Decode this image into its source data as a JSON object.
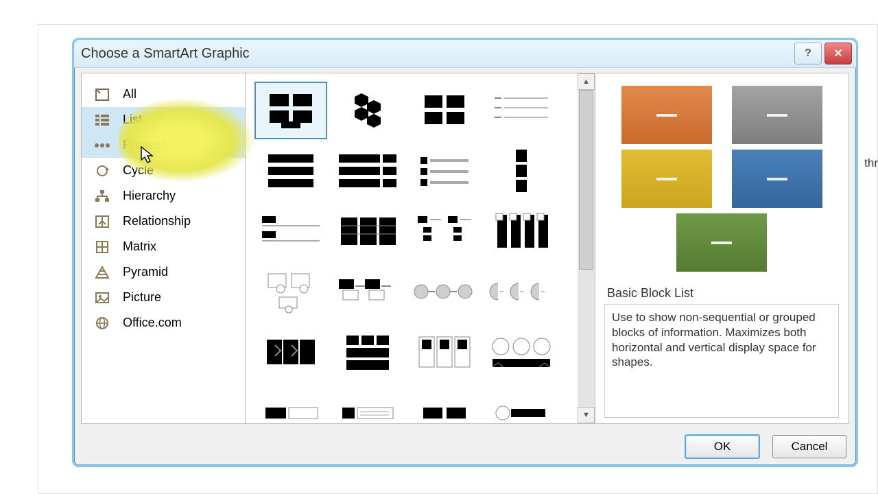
{
  "dialog": {
    "title": "Choose a SmartArt Graphic"
  },
  "backgroundText": "thr",
  "categories": [
    {
      "id": "all",
      "label": "All"
    },
    {
      "id": "list",
      "label": "List"
    },
    {
      "id": "process",
      "label": "Process"
    },
    {
      "id": "cycle",
      "label": "Cycle"
    },
    {
      "id": "hierarchy",
      "label": "Hierarchy"
    },
    {
      "id": "relationship",
      "label": "Relationship"
    },
    {
      "id": "matrix",
      "label": "Matrix"
    },
    {
      "id": "pyramid",
      "label": "Pyramid"
    },
    {
      "id": "picture",
      "label": "Picture"
    },
    {
      "id": "officecom",
      "label": "Office.com"
    }
  ],
  "selectedCategory": "list",
  "hoverCategory": "process",
  "selectedThumb": "basic-block-list",
  "preview": {
    "title": "Basic Block List",
    "description": "Use to show non-sequential or grouped blocks of information. Maximizes both horizontal and vertical display space for shapes.",
    "colors": [
      "#d97a3b",
      "#8f8f8f",
      "#d6b029",
      "#3b6fa8",
      "#5e8a3a"
    ]
  },
  "buttons": {
    "ok": "OK",
    "cancel": "Cancel"
  }
}
